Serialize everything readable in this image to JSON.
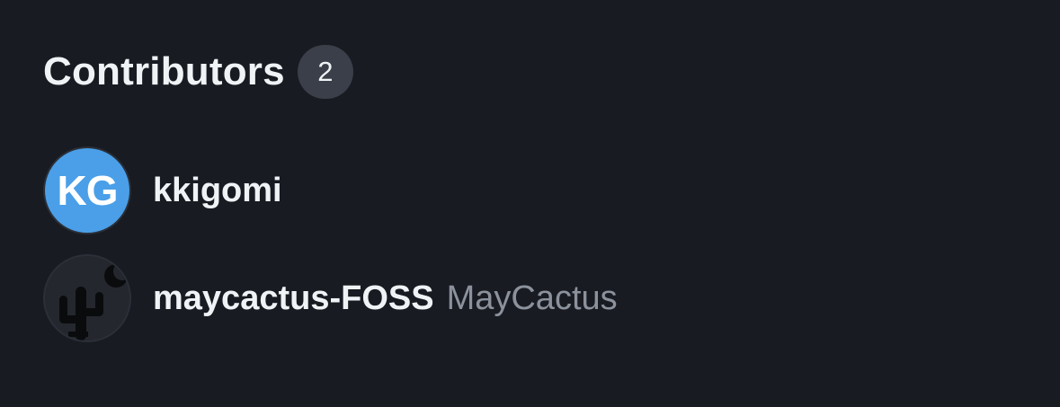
{
  "contributors": {
    "title": "Contributors",
    "count": "2",
    "items": [
      {
        "avatar": {
          "initials": "KG",
          "bg_color": "#4a9fe8"
        },
        "login": "kkigomi",
        "name": ""
      },
      {
        "avatar": {
          "icon": "cactus-moon-icon",
          "bg_color": "#24272e"
        },
        "login": "maycactus-FOSS",
        "name": "MayCactus"
      }
    ]
  }
}
